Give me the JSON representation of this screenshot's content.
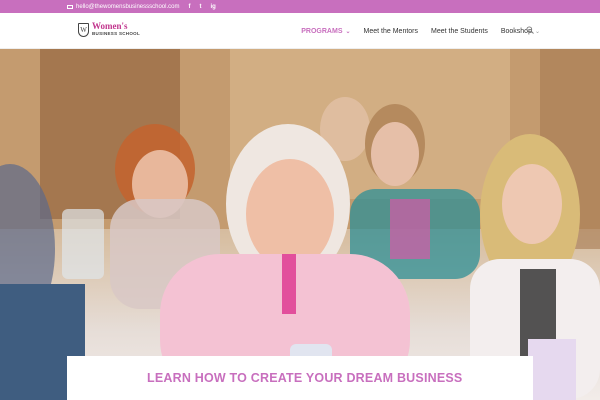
{
  "topbar": {
    "email": "hello@thewomensbusinessschool.com",
    "social": [
      "f",
      "t",
      "ig"
    ]
  },
  "logo": {
    "mark": "W",
    "name": "Women's",
    "subtitle": "BUSINESS SCHOOL"
  },
  "nav": {
    "items": [
      {
        "label": "PROGRAMS",
        "dropdown": true,
        "active": true
      },
      {
        "label": "Meet the Mentors",
        "dropdown": false,
        "active": false
      },
      {
        "label": "Meet the Students",
        "dropdown": false,
        "active": false
      },
      {
        "label": "Bookshop",
        "dropdown": true,
        "active": false
      }
    ]
  },
  "hero": {
    "cta": "LEARN HOW TO CREATE YOUR DREAM BUSINESS"
  },
  "colors": {
    "brand_pink": "#c86fbe",
    "logo_pink": "#c2368e"
  }
}
